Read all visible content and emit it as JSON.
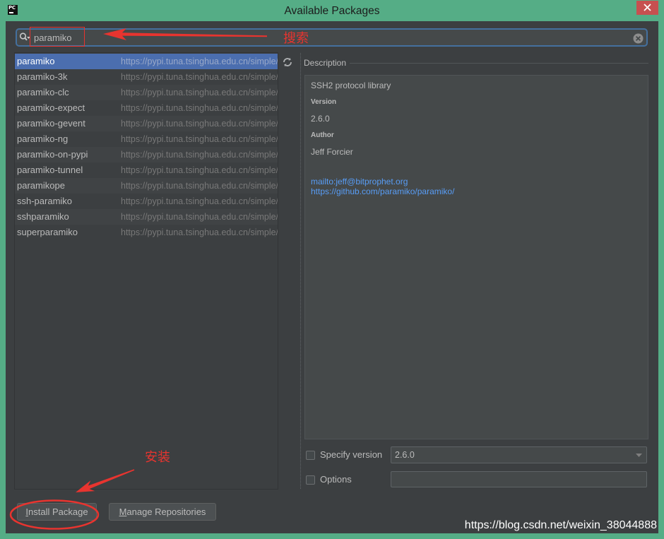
{
  "window": {
    "title": "Available Packages",
    "app_icon_label": "PC"
  },
  "search": {
    "value": "paramiko"
  },
  "packages": [
    {
      "name": "paramiko",
      "repository": "https://pypi.tuna.tsinghua.edu.cn/simple/",
      "selected": true
    },
    {
      "name": "paramiko-3k",
      "repository": "https://pypi.tuna.tsinghua.edu.cn/simple/",
      "selected": false
    },
    {
      "name": "paramiko-clc",
      "repository": "https://pypi.tuna.tsinghua.edu.cn/simple/",
      "selected": false
    },
    {
      "name": "paramiko-expect",
      "repository": "https://pypi.tuna.tsinghua.edu.cn/simple/",
      "selected": false
    },
    {
      "name": "paramiko-gevent",
      "repository": "https://pypi.tuna.tsinghua.edu.cn/simple/",
      "selected": false
    },
    {
      "name": "paramiko-ng",
      "repository": "https://pypi.tuna.tsinghua.edu.cn/simple/",
      "selected": false
    },
    {
      "name": "paramiko-on-pypi",
      "repository": "https://pypi.tuna.tsinghua.edu.cn/simple/",
      "selected": false
    },
    {
      "name": "paramiko-tunnel",
      "repository": "https://pypi.tuna.tsinghua.edu.cn/simple/",
      "selected": false
    },
    {
      "name": "paramikope",
      "repository": "https://pypi.tuna.tsinghua.edu.cn/simple/",
      "selected": false
    },
    {
      "name": "ssh-paramiko",
      "repository": "https://pypi.tuna.tsinghua.edu.cn/simple/",
      "selected": false
    },
    {
      "name": "sshparamiko",
      "repository": "https://pypi.tuna.tsinghua.edu.cn/simple/",
      "selected": false
    },
    {
      "name": "superparamiko",
      "repository": "https://pypi.tuna.tsinghua.edu.cn/simple/",
      "selected": false
    }
  ],
  "description": {
    "label": "Description",
    "summary": "SSH2 protocol library",
    "version_label": "Version",
    "version": "2.6.0",
    "author_label": "Author",
    "author": "Jeff Forcier",
    "links": [
      "mailto:jeff@bitprophet.org",
      "https://github.com/paramiko/paramiko/"
    ]
  },
  "specify_version": {
    "label": "Specify version",
    "checked": false,
    "value": "2.6.0"
  },
  "options": {
    "label": "Options",
    "checked": false,
    "value": ""
  },
  "buttons": {
    "install": "Install Package",
    "manage_repositories": "Manage Repositories"
  },
  "annotations": {
    "search_note": "搜索",
    "install_note": "安装"
  },
  "watermark": "https://blog.csdn.net/weixin_38044888",
  "icons": {
    "app": "pycharm-logo-icon",
    "close": "close-icon",
    "search": "search-icon",
    "clear": "clear-icon",
    "refresh": "refresh-icon",
    "dropdown": "chevron-down-icon"
  },
  "colors": {
    "window_frame": "#55ad86",
    "panel_bg": "#3c3f41",
    "selection": "#4b6eaf",
    "link": "#589df6",
    "annotation": "#e8342f",
    "close_button": "#c75050"
  }
}
